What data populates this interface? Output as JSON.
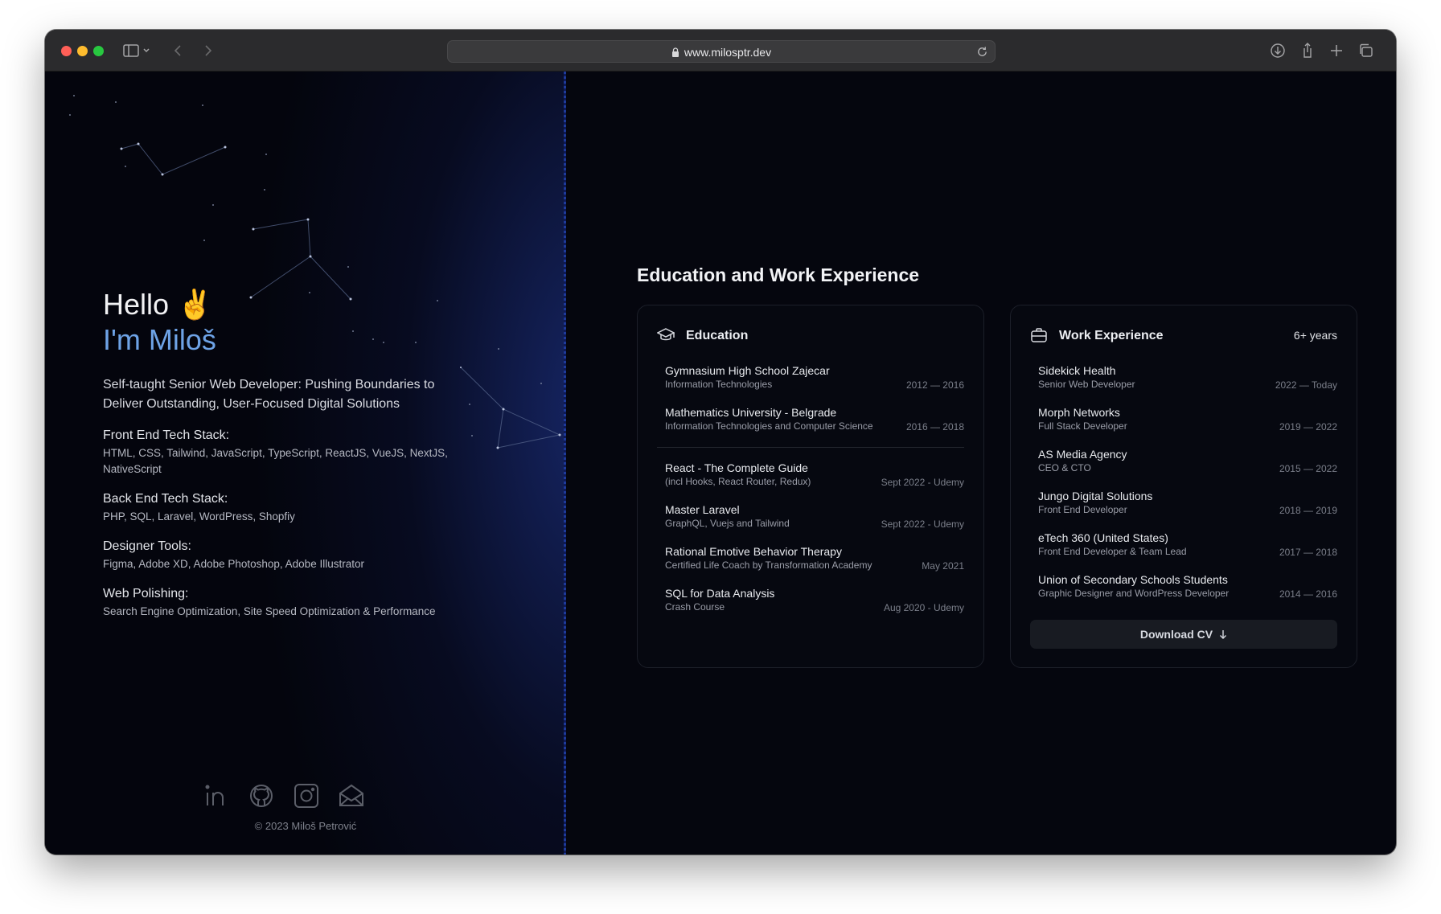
{
  "browser": {
    "url": "www.milosptr.dev"
  },
  "hero": {
    "hello": "Hello ✌️",
    "name": "I'm Miloš",
    "tagline": "Self-taught Senior Web Developer: Pushing Boundaries to Deliver Outstanding, User-Focused Digital Solutions",
    "stacks": [
      {
        "title": "Front End Tech Stack:",
        "items": "HTML, CSS, Tailwind, JavaScript, TypeScript, ReactJS, VueJS, NextJS, NativeScript"
      },
      {
        "title": "Back End Tech Stack:",
        "items": "PHP, SQL, Laravel, WordPress, Shopfiy"
      },
      {
        "title": "Designer Tools:",
        "items": "Figma, Adobe XD, Adobe Photoshop, Adobe Illustrator"
      },
      {
        "title": "Web Polishing:",
        "items": "Search Engine Optimization, Site Speed Optimization & Performance"
      }
    ]
  },
  "socials": [
    "linkedin-icon",
    "github-icon",
    "instagram-icon",
    "mail-icon"
  ],
  "footer": {
    "copyright": "© 2023 Miloš Petrović"
  },
  "experience": {
    "section_title": "Education and Work Experience",
    "education": {
      "title": "Education",
      "items": [
        {
          "title": "Gymnasium High School Zajecar",
          "sub": "Information Technologies",
          "date": "2012 — 2016"
        },
        {
          "title": "Mathematics University - Belgrade",
          "sub": "Information Technologies and Computer Science",
          "date": "2016 — 2018"
        },
        {
          "title": "React - The Complete Guide",
          "sub": "(incl Hooks, React Router, Redux)",
          "date": "Sept 2022 - Udemy"
        },
        {
          "title": "Master Laravel",
          "sub": "GraphQL, Vuejs and Tailwind",
          "date": "Sept 2022 - Udemy"
        },
        {
          "title": "Rational Emotive Behavior Therapy",
          "sub": "Certified Life Coach by Transformation Academy",
          "date": "May 2021"
        },
        {
          "title": "SQL for Data Analysis",
          "sub": "Crash Course",
          "date": "Aug 2020 - Udemy"
        }
      ]
    },
    "work": {
      "title": "Work Experience",
      "years": "6+ years",
      "items": [
        {
          "title": "Sidekick Health",
          "sub": "Senior Web Developer",
          "date": "2022 — Today"
        },
        {
          "title": "Morph Networks",
          "sub": "Full Stack Developer",
          "date": "2019 — 2022"
        },
        {
          "title": "AS Media Agency",
          "sub": "CEO & CTO",
          "date": "2015 — 2022"
        },
        {
          "title": "Jungo Digital Solutions",
          "sub": "Front End Developer",
          "date": "2018 — 2019"
        },
        {
          "title": "eTech 360 (United States)",
          "sub": "Front End Developer & Team Lead",
          "date": "2017 — 2018"
        },
        {
          "title": "Union of Secondary Schools Students",
          "sub": "Graphic Designer and WordPress Developer",
          "date": "2014 — 2016"
        }
      ],
      "download_label": "Download CV"
    }
  }
}
